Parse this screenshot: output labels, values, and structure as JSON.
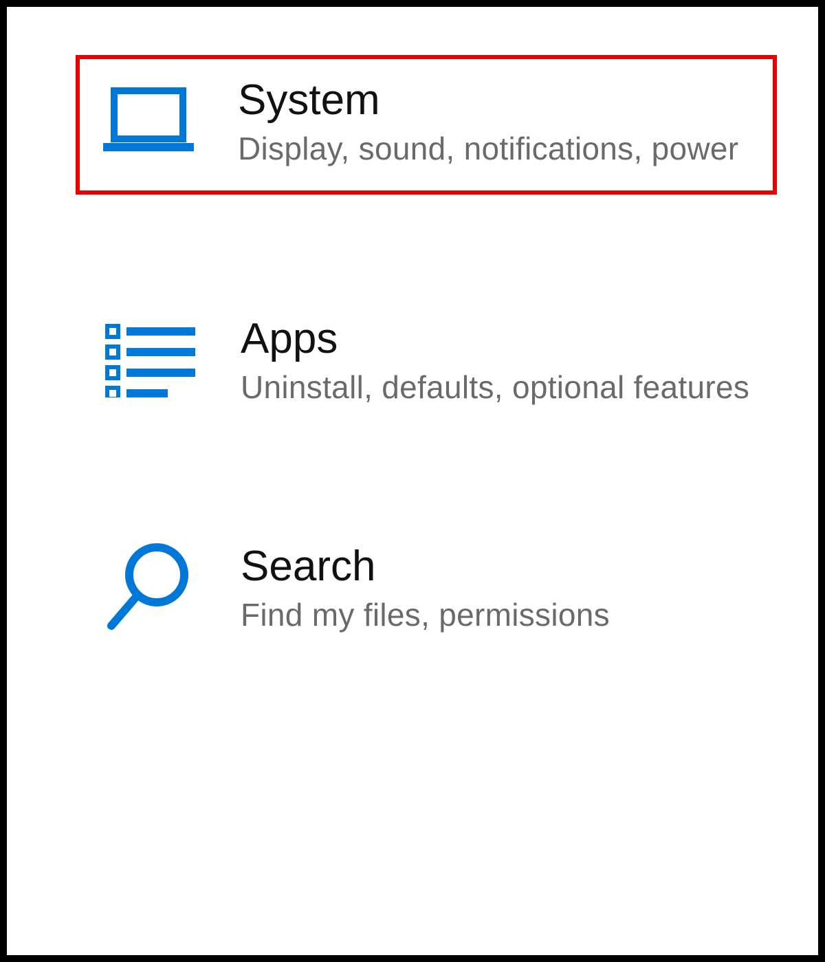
{
  "settings": {
    "items": [
      {
        "id": "system",
        "title": "System",
        "subtitle": "Display, sound, notifications, power",
        "icon": "laptop-icon",
        "highlighted": true
      },
      {
        "id": "apps",
        "title": "Apps",
        "subtitle": "Uninstall, defaults, optional features",
        "icon": "list-icon",
        "highlighted": false
      },
      {
        "id": "search",
        "title": "Search",
        "subtitle": "Find my files, permissions",
        "icon": "search-icon",
        "highlighted": false
      }
    ]
  },
  "colors": {
    "accent": "#0078d7",
    "highlight_border": "#e60000",
    "text_primary": "#111111",
    "text_secondary": "#6a6a6a"
  }
}
